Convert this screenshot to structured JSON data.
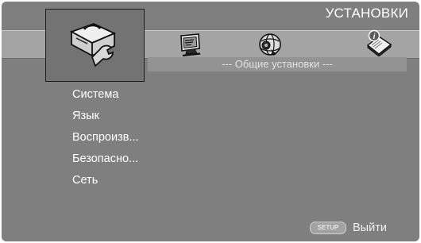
{
  "header": {
    "title": "УСТАНОВКИ"
  },
  "tabs": [
    {
      "icon": "toolbox-wrench-icon",
      "selected": true
    },
    {
      "icon": "monitor-icon",
      "selected": false
    },
    {
      "icon": "speaker-globe-icon",
      "selected": false
    },
    {
      "icon": "info-book-icon",
      "selected": false
    }
  ],
  "section": {
    "title": "--- Общие установки ---"
  },
  "menu": {
    "items": [
      {
        "label": "Система"
      },
      {
        "label": "Язык"
      },
      {
        "label": "Воспроизв..."
      },
      {
        "label": "Безопасно..."
      },
      {
        "label": "Сеть"
      }
    ]
  },
  "footer": {
    "setup_button": "SETUP",
    "exit_label": "Выйти"
  },
  "colors": {
    "background": "#7f7f7f",
    "tab_bar": "#a4a4a4",
    "selected_tab": "#737373",
    "text": "#ffffff"
  }
}
